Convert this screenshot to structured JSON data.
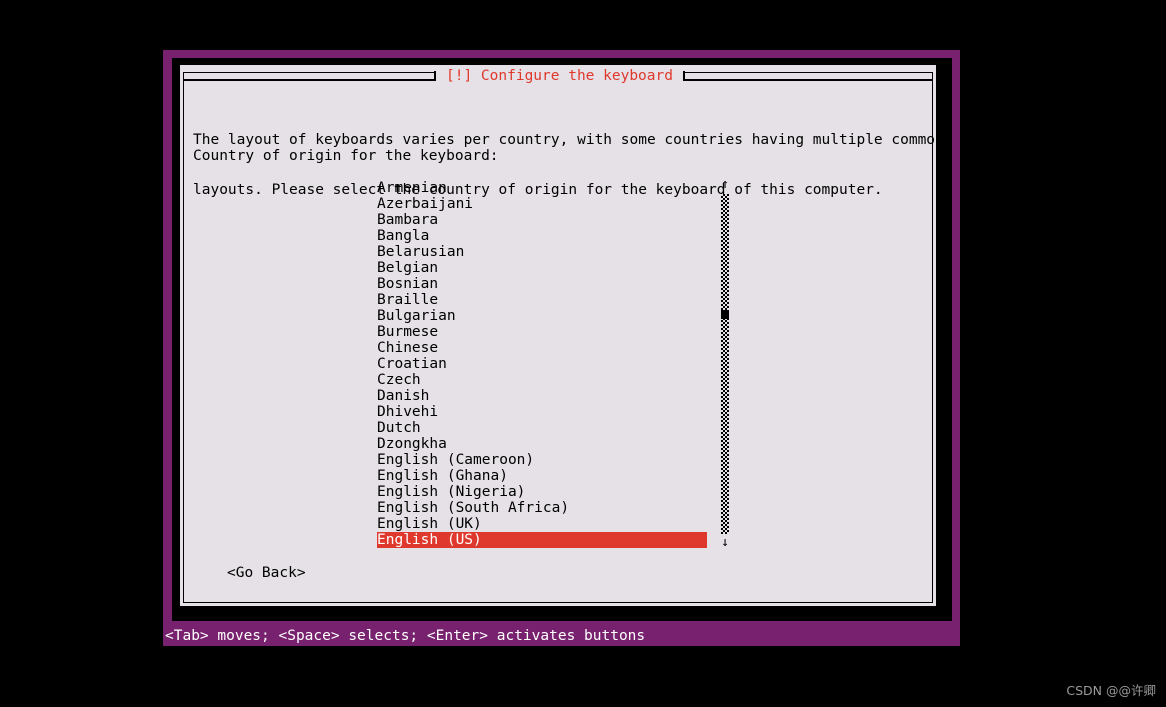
{
  "theme": {
    "backdrop_purple": "#77216F",
    "terminal_black": "#000000",
    "dialog_bg": "#E5E1E6",
    "title_red": "#DF382C",
    "highlight_red": "#DF382C",
    "highlight_text": "#FFFFFF",
    "text_black": "#000000",
    "statusbar_text": "#FFFFFF"
  },
  "dialog": {
    "title": "[!] Configure the keyboard",
    "description_lines": [
      "The layout of keyboards varies per country, with some countries having multiple common",
      "layouts. Please select the country of origin for the keyboard of this computer."
    ],
    "prompt": "Country of origin for the keyboard:",
    "list": {
      "items": [
        "Armenian",
        "Azerbaijani",
        "Bambara",
        "Bangla",
        "Belarusian",
        "Belgian",
        "Bosnian",
        "Braille",
        "Bulgarian",
        "Burmese",
        "Chinese",
        "Croatian",
        "Czech",
        "Danish",
        "Dhivehi",
        "Dutch",
        "Dzongkha",
        "English (Cameroon)",
        "English (Ghana)",
        "English (Nigeria)",
        "English (South Africa)",
        "English (UK)",
        "English (US)"
      ],
      "selected_index": 22,
      "selected_value": "English (US)"
    },
    "scrollbar": {
      "up_arrow": "↑",
      "down_arrow": "↓",
      "thumb_position_percent": 35
    },
    "buttons": {
      "go_back": "<Go Back>"
    }
  },
  "statusbar": {
    "text": "<Tab> moves; <Space> selects; <Enter> activates buttons"
  },
  "watermark": {
    "text": "CSDN @@许卿"
  }
}
